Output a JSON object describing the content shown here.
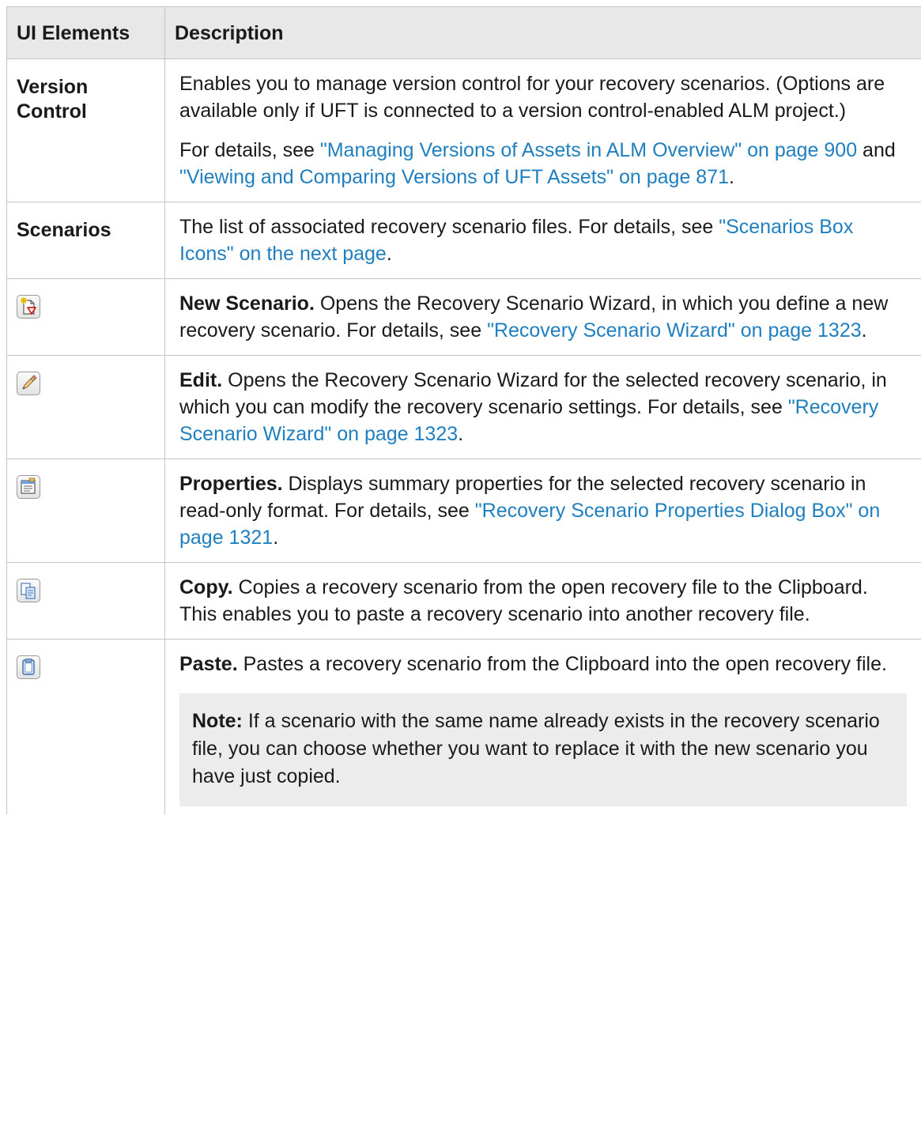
{
  "table": {
    "header": {
      "col1": "UI Elements",
      "col2": "Description"
    },
    "rows": [
      {
        "element": "Version Control",
        "para1": "Enables you to manage version control for your recovery scenarios. (Options are available only if UFT is connected to a version control-enabled ALM project.)",
        "para2_prefix": "For details, see ",
        "link1": "\"Managing Versions of Assets in ALM Overview\" on page 900",
        "para2_mid": " and ",
        "link2": "\"Viewing and Comparing Versions of UFT Assets\" on page 871",
        "para2_suffix": "."
      },
      {
        "element": "Scenarios",
        "text": "The list of associated recovery scenario files. For details, see ",
        "link": "\"Scenarios Box Icons\" on the next page",
        "suffix": "."
      },
      {
        "icon": "new-scenario-icon",
        "term": "New Scenario.",
        "text": " Opens the Recovery Scenario Wizard, in which you define a new recovery scenario. For details, see ",
        "link": "\"Recovery Scenario Wizard\" on page 1323",
        "suffix": "."
      },
      {
        "icon": "edit-icon",
        "term": "Edit.",
        "text": " Opens the Recovery Scenario Wizard for the selected recovery scenario, in which you can modify the recovery scenario settings. For details, see ",
        "link": "\"Recovery Scenario Wizard\" on page 1323",
        "suffix": "."
      },
      {
        "icon": "properties-icon",
        "term": "Properties.",
        "text": " Displays summary properties for the selected recovery scenario in read-only format. For details, see ",
        "link": "\"Recovery Scenario Properties Dialog Box\" on page 1321",
        "suffix": "."
      },
      {
        "icon": "copy-icon",
        "term": "Copy.",
        "text": " Copies a recovery scenario from the open recovery file to the Clipboard. This enables you to paste a recovery scenario into another recovery file."
      },
      {
        "icon": "paste-icon",
        "term": "Paste.",
        "text": " Pastes a recovery scenario from the Clipboard into the open recovery file.",
        "note_label": "Note:",
        "note_text": " If a scenario with the same name already exists in the recovery scenario file, you can choose whether you want to replace it with the new scenario you have just copied."
      }
    ]
  },
  "colors": {
    "link": "#1f7fbf",
    "header_bg": "#e8e8e8",
    "note_bg": "#ececec",
    "border": "#c4c4c4"
  }
}
